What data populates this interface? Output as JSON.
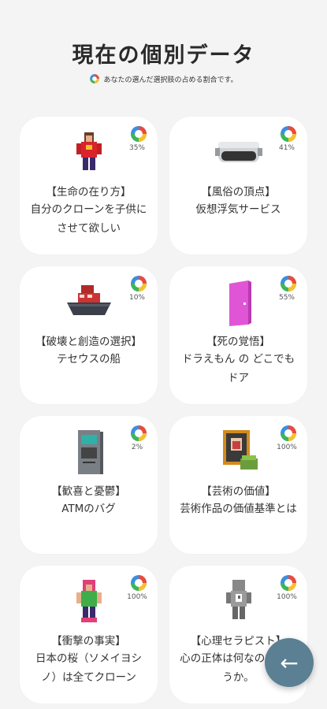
{
  "header": {
    "title": "現在の個別データ",
    "subtitle": "あなたの選んだ選択肢の占める割合です。"
  },
  "cards": [
    {
      "category": "【生命の在り方】",
      "description": "自分のクローンを子供にさせて欲しい",
      "percent": "35%",
      "percent_value": 35,
      "illustration": "pixel-person-red-icon"
    },
    {
      "category": "【風俗の頂点】",
      "description": "仮想浮気サービス",
      "percent": "41%",
      "percent_value": 41,
      "illustration": "vr-headset-icon"
    },
    {
      "category": "【破壊と創造の選択】",
      "description": "テセウスの船",
      "percent": "10%",
      "percent_value": 10,
      "illustration": "ship-icon"
    },
    {
      "category": "【死の覚悟】",
      "description": "ドラえもん の どこでもドア",
      "percent": "55%",
      "percent_value": 55,
      "illustration": "pink-door-icon"
    },
    {
      "category": "【歓喜と憂鬱】",
      "description": "ATMのバグ",
      "percent": "2%",
      "percent_value": 2,
      "illustration": "atm-icon"
    },
    {
      "category": "【芸術の価値】",
      "description": "芸術作品の価値基準とは",
      "percent": "100%",
      "percent_value": 100,
      "illustration": "framed-painting-icon"
    },
    {
      "category": "【衝撃の事実】",
      "description": "日本の桜（ソメイヨシノ）は全てクローン",
      "percent": "100%",
      "percent_value": 100,
      "illustration": "pixel-person-pink-icon"
    },
    {
      "category": "【心理セラピスト】",
      "description": "心の正体は何なのでしょうか。",
      "percent": "100%",
      "percent_value": 100,
      "illustration": "pixel-person-grey-icon"
    }
  ],
  "fab": {
    "icon": "arrow-left-icon",
    "glyph": "←"
  },
  "colors": {
    "pie_red": "#e94b3c",
    "pie_yellow": "#f6c22b",
    "pie_green": "#3ab65a",
    "pie_blue": "#3b8fe0",
    "fab": "#5b7f93"
  }
}
